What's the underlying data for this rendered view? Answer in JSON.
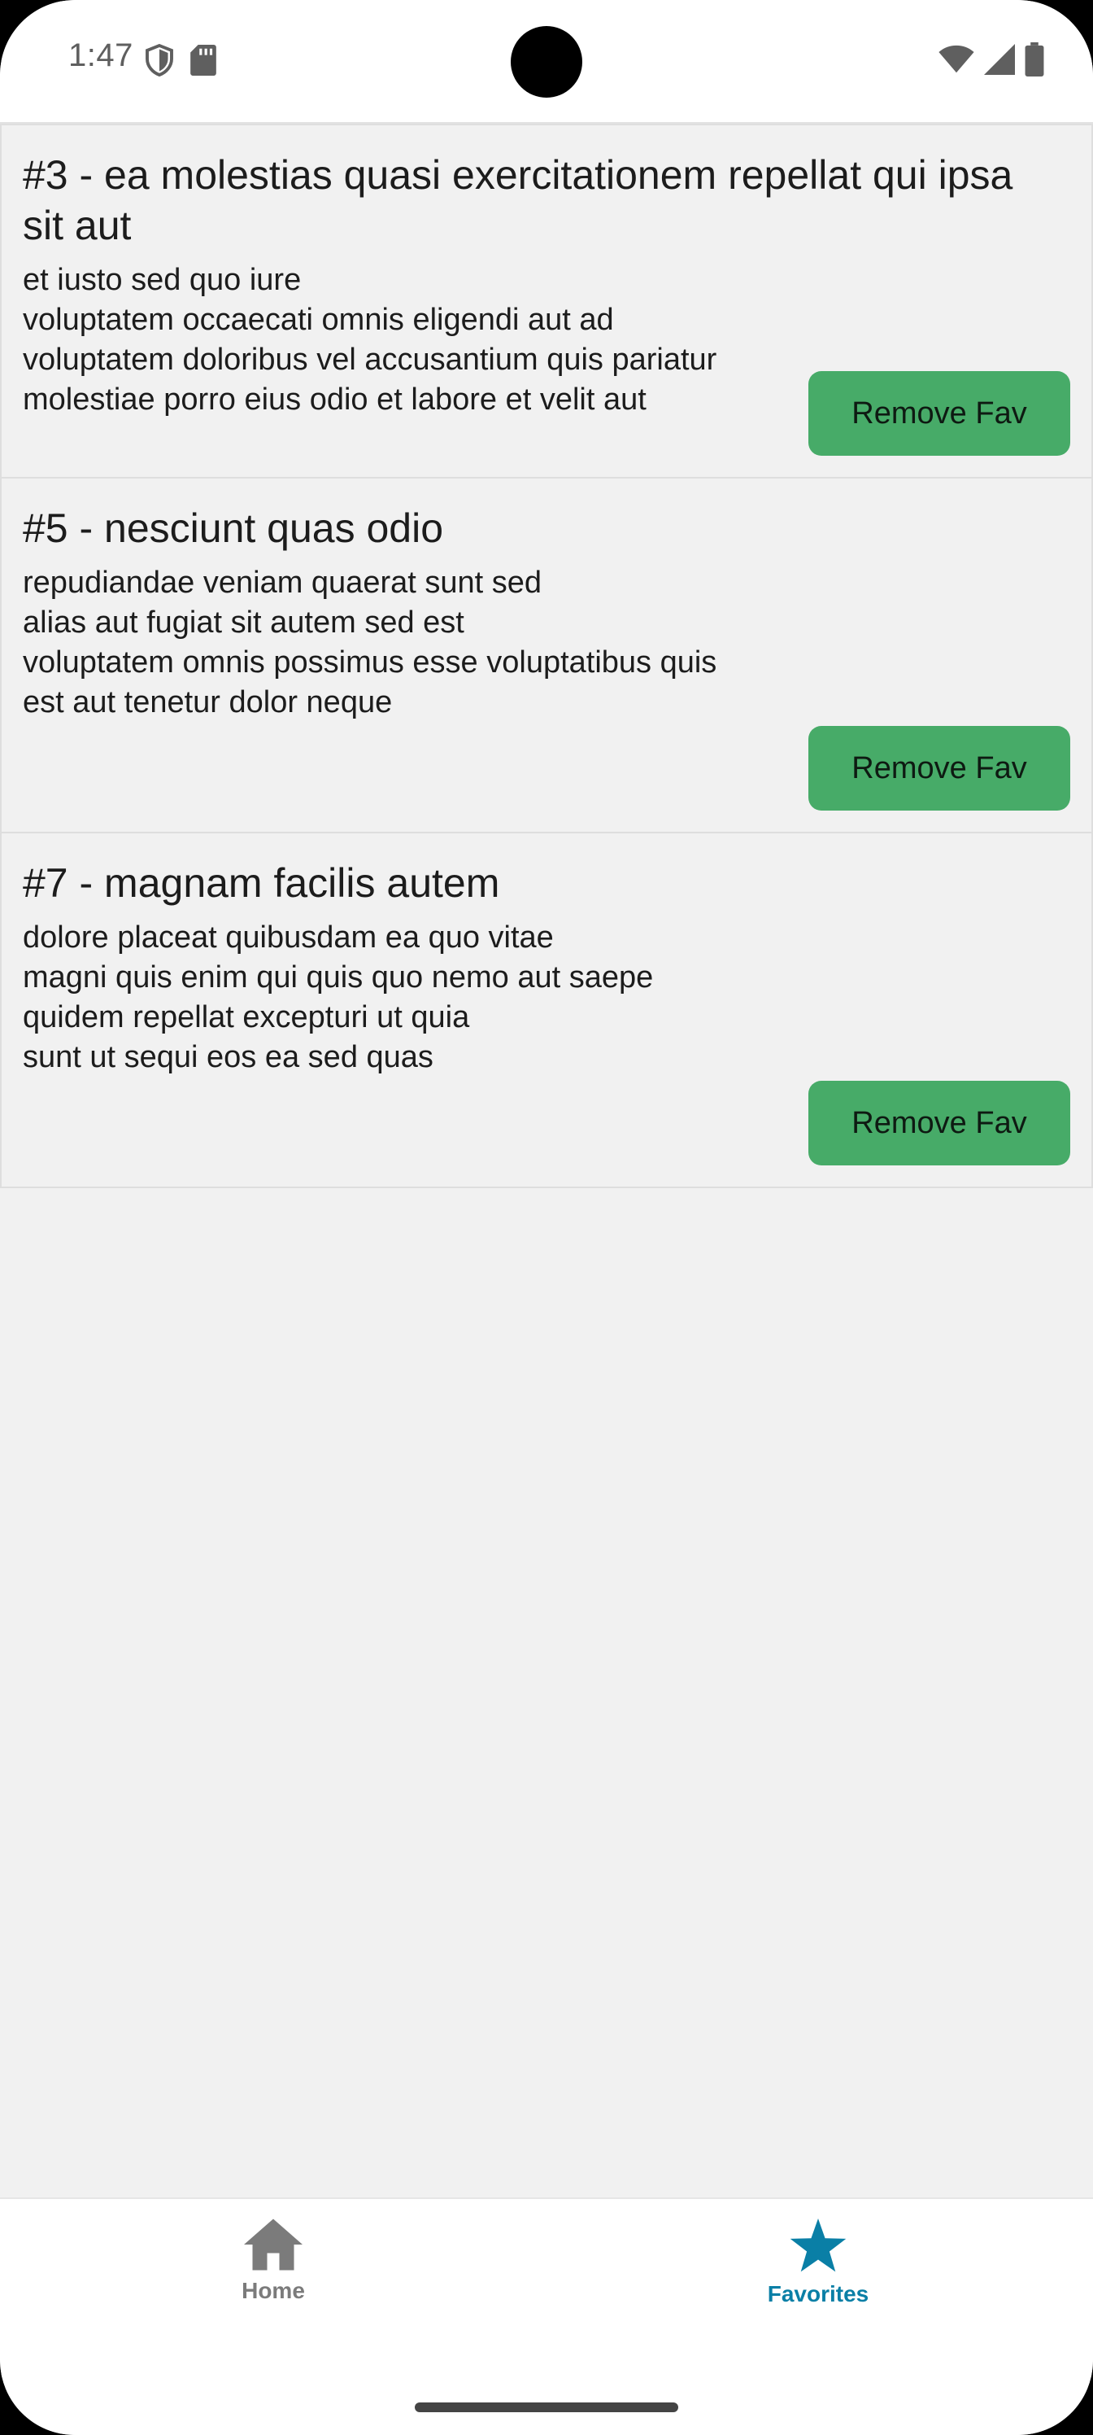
{
  "status_bar": {
    "time": "1:47",
    "icons": [
      "shield-icon",
      "sd-card-icon",
      "wifi-icon",
      "signal-icon",
      "battery-icon"
    ]
  },
  "favorites": [
    {
      "title": "#3 - ea molestias quasi exercitationem repellat qui ipsa sit aut",
      "body": "et iusto sed quo iure\nvoluptatem occaecati omnis eligendi aut ad\nvoluptatem doloribus vel accusantium quis pariatur\nmolestiae porro eius odio et labore et velit aut",
      "button_label": "Remove Fav"
    },
    {
      "title": "#5 - nesciunt quas odio",
      "body": "repudiandae veniam quaerat sunt sed\nalias aut fugiat sit autem sed est\nvoluptatem omnis possimus esse voluptatibus quis\nest aut tenetur dolor neque",
      "button_label": "Remove Fav"
    },
    {
      "title": "#7 - magnam facilis autem",
      "body": "dolore placeat quibusdam ea quo vitae\nmagni quis enim qui quis quo nemo aut saepe\nquidem repellat excepturi ut quia\nsunt ut sequi eos ea sed quas",
      "button_label": "Remove Fav"
    }
  ],
  "bottom_nav": {
    "items": [
      {
        "label": "Home",
        "icon": "home-icon",
        "active": false
      },
      {
        "label": "Favorites",
        "icon": "star-icon",
        "active": true
      }
    ]
  },
  "colors": {
    "button_green": "#47ab68",
    "active_tab": "#0a7fa6",
    "inactive_tab": "#7b7b7b",
    "background": "#f1f1f1"
  }
}
